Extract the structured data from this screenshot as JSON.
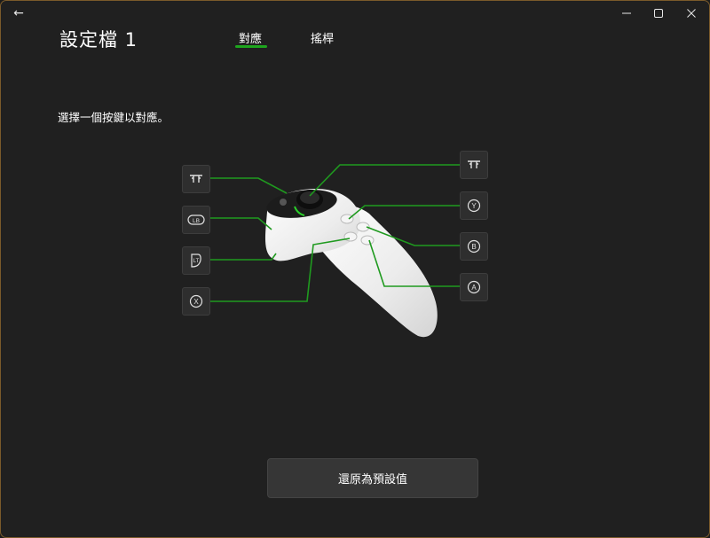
{
  "window": {
    "back_icon": "←",
    "controls": [
      "minimize-icon",
      "maximize-icon",
      "close-icon"
    ]
  },
  "page": {
    "title": "設定檔 1"
  },
  "tabs": [
    {
      "label": "對應",
      "selected": true
    },
    {
      "label": "搖桿",
      "selected": false
    }
  ],
  "instruction": "選擇一個按鍵以對應。",
  "mapping_buttons": [
    {
      "name": "trigger-icon",
      "label": "",
      "side": "left"
    },
    {
      "name": "lb-icon",
      "label": "LB",
      "side": "left"
    },
    {
      "name": "lt-icon",
      "label": "LT",
      "side": "left"
    },
    {
      "name": "x-button-icon",
      "label": "X",
      "side": "left"
    },
    {
      "name": "trigger-icon",
      "label": "",
      "side": "right"
    },
    {
      "name": "y-button-icon",
      "label": "Y",
      "side": "right"
    },
    {
      "name": "b-button-icon",
      "label": "B",
      "side": "right"
    },
    {
      "name": "a-button-icon",
      "label": "A",
      "side": "right"
    }
  ],
  "reset_button": {
    "label": "還原為預設值"
  },
  "colors": {
    "accent": "#1ea51e",
    "background": "#202020",
    "button": "#2e2e2e"
  }
}
